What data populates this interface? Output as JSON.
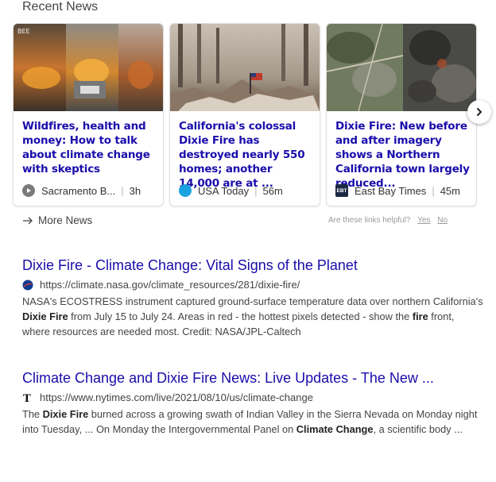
{
  "section": {
    "title": "Recent News"
  },
  "cards": [
    {
      "title": "Wildfires, health and money: How to talk about climate change with skeptics",
      "source": "Sacramento B...",
      "time": "3h",
      "thumb": "wildfire-street-image",
      "logo_text": ""
    },
    {
      "title": "California's colossal Dixie Fire has destroyed nearly 550 homes; another 14,000 are at ...",
      "source": "USA Today",
      "time": "56m",
      "thumb": "burned-ruins-flag-image",
      "logo_text": ""
    },
    {
      "title": "Dixie Fire: New before and after imagery shows a Northern California town largely reduced...",
      "source": "East Bay Times",
      "time": "45m",
      "thumb": "satellite-before-after-image",
      "logo_text": "EBT"
    }
  ],
  "more_news": {
    "label": "More News"
  },
  "feedback": {
    "question": "Are these links helpful?",
    "yes": "Yes",
    "no": "No"
  },
  "results": [
    {
      "title": "Dixie Fire - Climate Change: Vital Signs of the Planet",
      "url": "https://climate.nasa.gov/climate_resources/281/dixie-fire/",
      "snippet_parts": [
        {
          "t": "NASA's ECOSTRESS instrument captured ground-surface temperature data over northern California's ",
          "b": false
        },
        {
          "t": "Dixie Fire",
          "b": true
        },
        {
          "t": " from July 15 to July 24. Areas in red - the hottest pixels detected - show the ",
          "b": false
        },
        {
          "t": "fire",
          "b": true
        },
        {
          "t": " front, where resources are needed most. Credit: NASA/JPL-Caltech",
          "b": false
        }
      ]
    },
    {
      "title": "Climate Change and Dixie Fire News: Live Updates - The New ...",
      "url": "https://www.nytimes.com/live/2021/08/10/us/climate-change",
      "snippet_parts": [
        {
          "t": "The ",
          "b": false
        },
        {
          "t": "Dixie Fire",
          "b": true
        },
        {
          "t": " burned across a growing swath of Indian Valley in the Sierra Nevada on Monday night into Tuesday, ... On Monday the Intergovernmental Panel on ",
          "b": false
        },
        {
          "t": "Climate Change",
          "b": true
        },
        {
          "t": ", a scientific body ...",
          "b": false
        }
      ]
    }
  ],
  "colors": {
    "link": "#1a0dab",
    "text": "#444444",
    "muted": "#9a9a9a"
  }
}
